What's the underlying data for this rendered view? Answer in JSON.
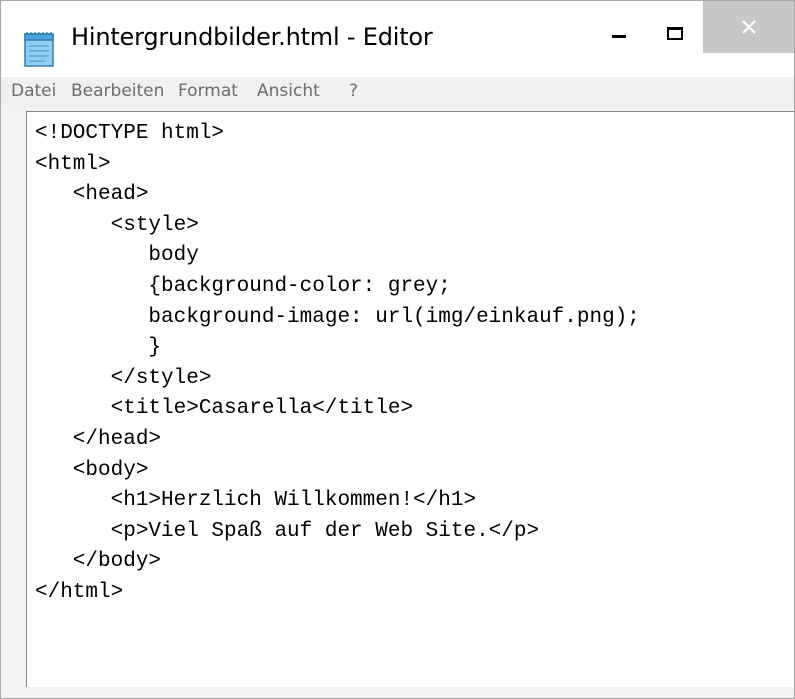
{
  "window": {
    "title": "Hintergrundbilder.html - Editor"
  },
  "icons": {
    "app": "notepad-icon",
    "minimize": "minimize-icon",
    "maximize": "maximize-icon",
    "close": "close-icon"
  },
  "colors": {
    "titlebar_bg": "#ffffff",
    "close_button_bg": "#c7c7c7",
    "menubar_bg": "#f0f0f0",
    "menu_text": "#6d6d6d",
    "editor_bg": "#ffffff",
    "code_text": "#000000"
  },
  "menu": {
    "items": [
      {
        "label": "Datei"
      },
      {
        "label": "Bearbeiten"
      },
      {
        "label": "Format"
      },
      {
        "label": "Ansicht"
      },
      {
        "label": "?"
      }
    ]
  },
  "editor": {
    "lines": [
      "<!DOCTYPE html>",
      "<html>",
      "   <head>",
      "      <style>",
      "         body",
      "         {background-color: grey;",
      "         background-image: url(img/einkauf.png);",
      "         }",
      "      </style>",
      "      <title>Casarella</title>",
      "   </head>",
      "   <body>",
      "      <h1>Herzlich Willkommen!</h1>",
      "      <p>Viel Spaß auf der Web Site.</p>",
      "   </body>",
      "</html>"
    ]
  }
}
